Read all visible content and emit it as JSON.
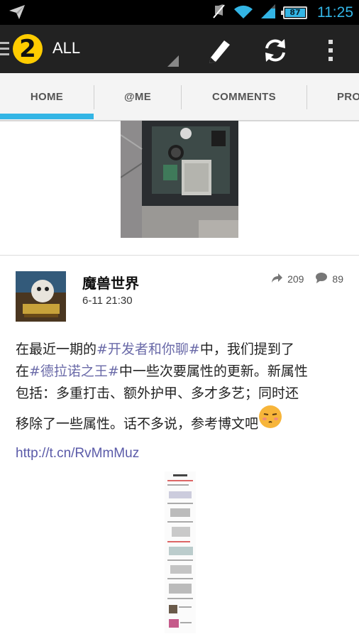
{
  "status_bar": {
    "time": "11:25",
    "battery_level": "87",
    "icons": [
      "send-icon",
      "mute-icon",
      "wifi-icon",
      "signal-icon",
      "battery-icon"
    ]
  },
  "action_bar": {
    "account_label": "ALL",
    "logo_number": "2",
    "actions": [
      "compose-icon",
      "refresh-icon",
      "overflow-menu-icon"
    ]
  },
  "tabs": [
    {
      "label": "HOME",
      "selected": true
    },
    {
      "label": "@ME",
      "selected": false
    },
    {
      "label": "COMMENTS",
      "selected": false
    },
    {
      "label": "PRO",
      "selected": false
    }
  ],
  "post": {
    "user": "魔兽世界",
    "time": "6-11 21:30",
    "reposts": "209",
    "comments": "89",
    "text": {
      "l1_a": "在最近一期的",
      "l1_tag": "#开发者和你聊#",
      "l1_b": "中，我们提到了",
      "l2_a": "在",
      "l2_tag": "#德拉诺之王#",
      "l2_b": "中一些次要属性的更新。新属性",
      "l3": "包括：多重打击、额外护甲、多才多艺；同时还",
      "l4": "移除了一些属性。话不多说，参考博文吧",
      "link": "http://t.cn/RvMmMuz"
    }
  },
  "colors": {
    "accent": "#33b5e5",
    "action_bar": "#222222",
    "hashtag": "#6a6aa8"
  }
}
